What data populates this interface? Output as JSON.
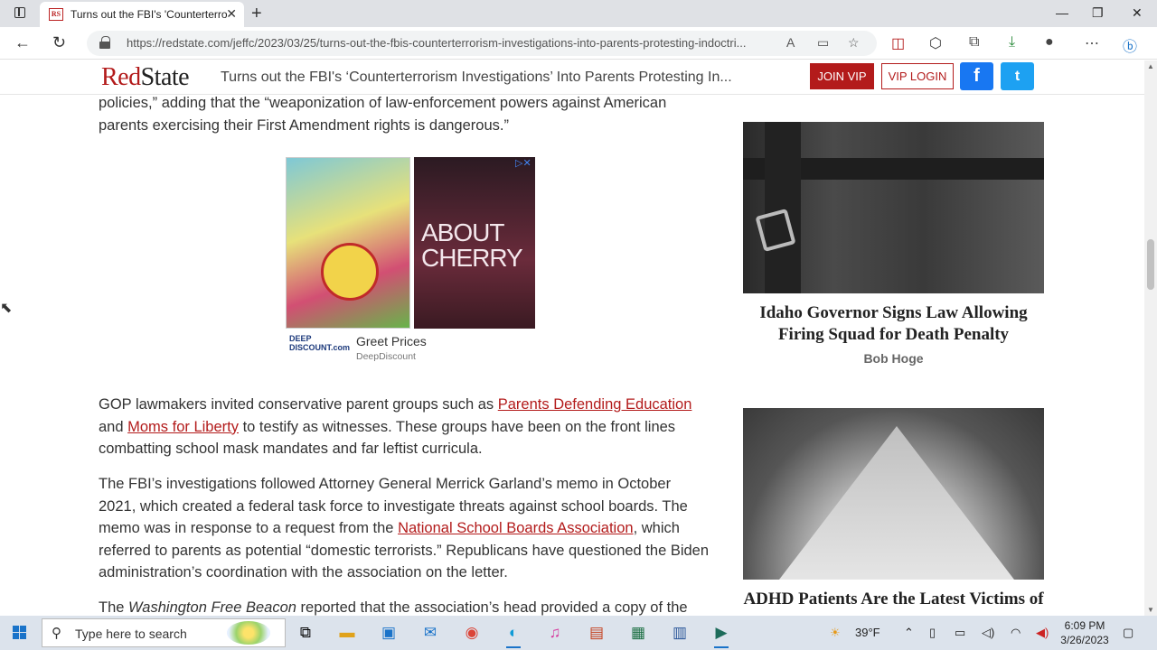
{
  "browser": {
    "tab_title": "Turns out the FBI's 'Counterterro",
    "tab_favicon": "RS",
    "url": "https://redstate.com/jeffc/2023/03/25/turns-out-the-fbis-counterterrorism-investigations-into-parents-protesting-indoctri..."
  },
  "site": {
    "logo_red": "Red",
    "logo_dark": "State",
    "header_title": "Turns out the FBI's ‘Counterterrorism Investigations’ Into Parents Protesting In...",
    "join_vip": "JOIN VIP",
    "vip_login": "VIP LOGIN",
    "facebook": "f",
    "twitter": "t"
  },
  "article": {
    "p0": "policies,” adding that the “weaponization of law-enforcement powers against American parents exercising their First Amendment rights is dangerous.”",
    "p1_a": "GOP lawmakers invited conservative parent groups such as ",
    "p1_link1": "Parents Defending Education",
    "p1_b": " and ",
    "p1_link2": "Moms for Liberty",
    "p1_c": " to testify as witnesses. These groups have been on the front lines combatting school mask mandates and far leftist curricula.",
    "p2_a": "The FBI’s investigations followed Attorney General Merrick Garland’s memo in October 2021, which created a federal task force to investigate threats against school boards. The memo was in response to a request from the ",
    "p2_link": "National School Boards Association",
    "p2_b": ", which referred to parents as potential “domestic terrorists.” Republicans have questioned the Biden administration’s coordination with the association on the letter.",
    "p3_a": "The ",
    "p3_em": "Washington Free Beacon",
    "p3_b": " reported that the association’s head provided a copy of the"
  },
  "ad": {
    "movie_title": "ABOUT CHERRY",
    "advertiser_logo": "DEEP DISCOUNT.com",
    "headline": "Greet Prices",
    "advertiser": "DeepDiscount"
  },
  "sidebar": {
    "story1_title": "Idaho Governor Signs Law Allowing Firing Squad for Death Penalty",
    "story1_author": "Bob Hoge",
    "story2_title": "ADHD Patients Are the Latest Victims of"
  },
  "taskbar": {
    "search_placeholder": "Type here to search",
    "weather": "39°F",
    "time": "6:09 PM",
    "date": "3/26/2023"
  }
}
